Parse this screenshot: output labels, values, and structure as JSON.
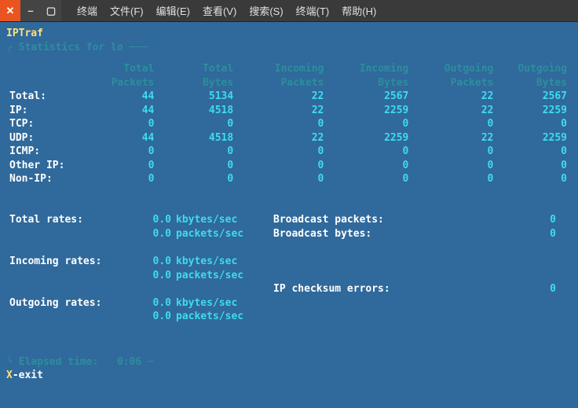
{
  "titlebar": {
    "menus": [
      "终端",
      "文件(F)",
      "编辑(E)",
      "查看(V)",
      "搜索(S)",
      "终端(T)",
      "帮助(H)"
    ]
  },
  "app": {
    "title": "IPTraf",
    "frame_label": " Statistics for lo ",
    "elapsed_label": " Elapsed time:",
    "elapsed_value": "0:06",
    "exit_key": "X",
    "exit_desc": "-exit"
  },
  "headers": {
    "h1a": "Total",
    "h1b": "Packets",
    "h2a": "Total",
    "h2b": "Bytes",
    "h3a": "Incoming",
    "h3b": "Packets",
    "h4a": "Incoming",
    "h4b": "Bytes",
    "h5a": "Outgoing",
    "h5b": "Packets",
    "h6a": "Outgoing",
    "h6b": "Bytes"
  },
  "rows": {
    "total": {
      "label": "Total:",
      "v": [
        "44",
        "5134",
        "22",
        "2567",
        "22",
        "2567"
      ]
    },
    "ip": {
      "label": "IP:",
      "v": [
        "44",
        "4518",
        "22",
        "2259",
        "22",
        "2259"
      ]
    },
    "tcp": {
      "label": "TCP:",
      "v": [
        "0",
        "0",
        "0",
        "0",
        "0",
        "0"
      ]
    },
    "udp": {
      "label": "UDP:",
      "v": [
        "44",
        "4518",
        "22",
        "2259",
        "22",
        "2259"
      ]
    },
    "icmp": {
      "label": "ICMP:",
      "v": [
        "0",
        "0",
        "0",
        "0",
        "0",
        "0"
      ]
    },
    "otherip": {
      "label": "Other IP:",
      "v": [
        "0",
        "0",
        "0",
        "0",
        "0",
        "0"
      ]
    },
    "nonip": {
      "label": "Non-IP:",
      "v": [
        "0",
        "0",
        "0",
        "0",
        "0",
        "0"
      ]
    }
  },
  "rates": {
    "total_label": "Total rates:",
    "incoming_label": "Incoming rates:",
    "outgoing_label": "Outgoing rates:",
    "total_kb": "0.0",
    "total_pk": "0.0",
    "in_kb": "0.0",
    "in_pk": "0.0",
    "out_kb": "0.0",
    "out_pk": "0.0",
    "kb_unit": "kbytes/sec",
    "pk_unit": "packets/sec"
  },
  "side": {
    "bcast_pkts_label": "Broadcast packets:",
    "bcast_pkts_val": "0",
    "bcast_bytes_label": "Broadcast bytes:",
    "bcast_bytes_val": "0",
    "cksum_label": "IP checksum errors:",
    "cksum_val": "0"
  }
}
